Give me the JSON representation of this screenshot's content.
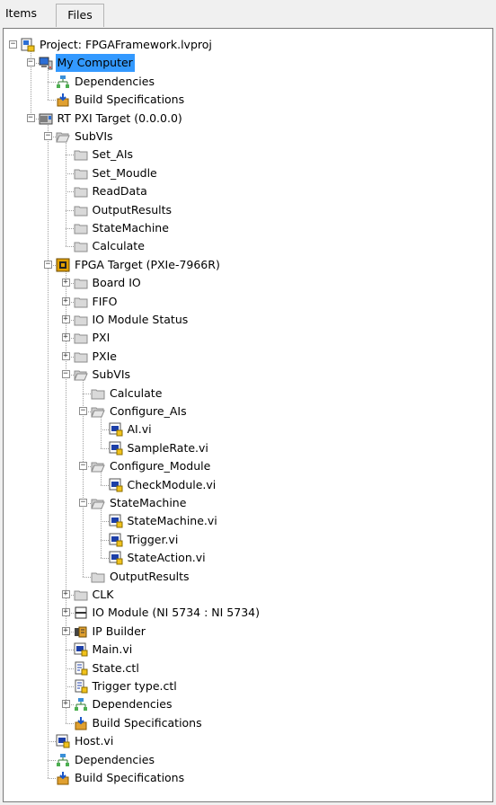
{
  "tabs": [
    {
      "label": "Items",
      "active": true
    },
    {
      "label": "Files",
      "active": false
    }
  ],
  "colors": {
    "selection": "#3399ff",
    "folder": "#d9d9d9",
    "vi_blue": "#1c3fa8",
    "vi_yellow": "#f1c21b"
  },
  "tree": [
    {
      "label": "Project: FPGAFramework.lvproj",
      "icon": "project-icon",
      "depth": 0,
      "expander": "-"
    },
    {
      "label": "My Computer",
      "icon": "computer-icon",
      "depth": 1,
      "expander": "-",
      "selected": true
    },
    {
      "label": "Dependencies",
      "icon": "dependencies-icon",
      "depth": 2,
      "expander": ""
    },
    {
      "label": "Build Specifications",
      "icon": "build-spec-icon",
      "depth": 2,
      "expander": ""
    },
    {
      "label": "RT PXI Target (0.0.0.0)",
      "icon": "rt-target-icon",
      "depth": 1,
      "expander": "-"
    },
    {
      "label": "SubVIs",
      "icon": "folder-open-icon",
      "depth": 2,
      "expander": "-"
    },
    {
      "label": "Set_AIs",
      "icon": "folder-icon",
      "depth": 3,
      "expander": ""
    },
    {
      "label": "Set_Moudle",
      "icon": "folder-icon",
      "depth": 3,
      "expander": ""
    },
    {
      "label": "ReadData",
      "icon": "folder-icon",
      "depth": 3,
      "expander": ""
    },
    {
      "label": "OutputResults",
      "icon": "folder-icon",
      "depth": 3,
      "expander": ""
    },
    {
      "label": "StateMachine",
      "icon": "folder-icon",
      "depth": 3,
      "expander": ""
    },
    {
      "label": "Calculate",
      "icon": "folder-icon",
      "depth": 3,
      "expander": ""
    },
    {
      "label": "FPGA Target (PXIe-7966R)",
      "icon": "fpga-target-icon",
      "depth": 2,
      "expander": "-"
    },
    {
      "label": "Board IO",
      "icon": "folder-icon",
      "depth": 3,
      "expander": "+"
    },
    {
      "label": "FIFO",
      "icon": "folder-icon",
      "depth": 3,
      "expander": "+"
    },
    {
      "label": "IO Module Status",
      "icon": "folder-icon",
      "depth": 3,
      "expander": "+"
    },
    {
      "label": "PXI",
      "icon": "folder-icon",
      "depth": 3,
      "expander": "+"
    },
    {
      "label": "PXIe",
      "icon": "folder-icon",
      "depth": 3,
      "expander": "+"
    },
    {
      "label": "SubVIs",
      "icon": "folder-open-icon",
      "depth": 3,
      "expander": "-"
    },
    {
      "label": "Calculate",
      "icon": "folder-icon",
      "depth": 4,
      "expander": ""
    },
    {
      "label": "Configure_AIs",
      "icon": "folder-open-icon",
      "depth": 4,
      "expander": "-"
    },
    {
      "label": "AI.vi",
      "icon": "vi-icon",
      "depth": 5,
      "expander": ""
    },
    {
      "label": "SampleRate.vi",
      "icon": "vi-icon",
      "depth": 5,
      "expander": ""
    },
    {
      "label": "Configure_Module",
      "icon": "folder-open-icon",
      "depth": 4,
      "expander": "-"
    },
    {
      "label": "CheckModule.vi",
      "icon": "vi-icon",
      "depth": 5,
      "expander": ""
    },
    {
      "label": "StateMachine",
      "icon": "folder-open-icon",
      "depth": 4,
      "expander": "-"
    },
    {
      "label": "StateMachine.vi",
      "icon": "vi-icon",
      "depth": 5,
      "expander": ""
    },
    {
      "label": "Trigger.vi",
      "icon": "vi-icon",
      "depth": 5,
      "expander": ""
    },
    {
      "label": "StateAction.vi",
      "icon": "vi-icon",
      "depth": 5,
      "expander": ""
    },
    {
      "label": "OutputResults",
      "icon": "folder-icon",
      "depth": 4,
      "expander": ""
    },
    {
      "label": "CLK",
      "icon": "folder-icon",
      "depth": 3,
      "expander": "+"
    },
    {
      "label": "IO Module (NI 5734 : NI 5734)",
      "icon": "io-module-icon",
      "depth": 3,
      "expander": "+"
    },
    {
      "label": "IP Builder",
      "icon": "ip-builder-icon",
      "depth": 3,
      "expander": "+"
    },
    {
      "label": "Main.vi",
      "icon": "vi-icon",
      "depth": 3,
      "expander": ""
    },
    {
      "label": "State.ctl",
      "icon": "ctl-icon",
      "depth": 3,
      "expander": ""
    },
    {
      "label": "Trigger type.ctl",
      "icon": "ctl-icon",
      "depth": 3,
      "expander": ""
    },
    {
      "label": "Dependencies",
      "icon": "dependencies-icon",
      "depth": 3,
      "expander": "+"
    },
    {
      "label": "Build Specifications",
      "icon": "build-spec-icon",
      "depth": 3,
      "expander": ""
    },
    {
      "label": "Host.vi",
      "icon": "vi-icon",
      "depth": 2,
      "expander": ""
    },
    {
      "label": "Dependencies",
      "icon": "dependencies-icon",
      "depth": 2,
      "expander": ""
    },
    {
      "label": "Build Specifications",
      "icon": "build-spec-icon",
      "depth": 2,
      "expander": ""
    }
  ]
}
